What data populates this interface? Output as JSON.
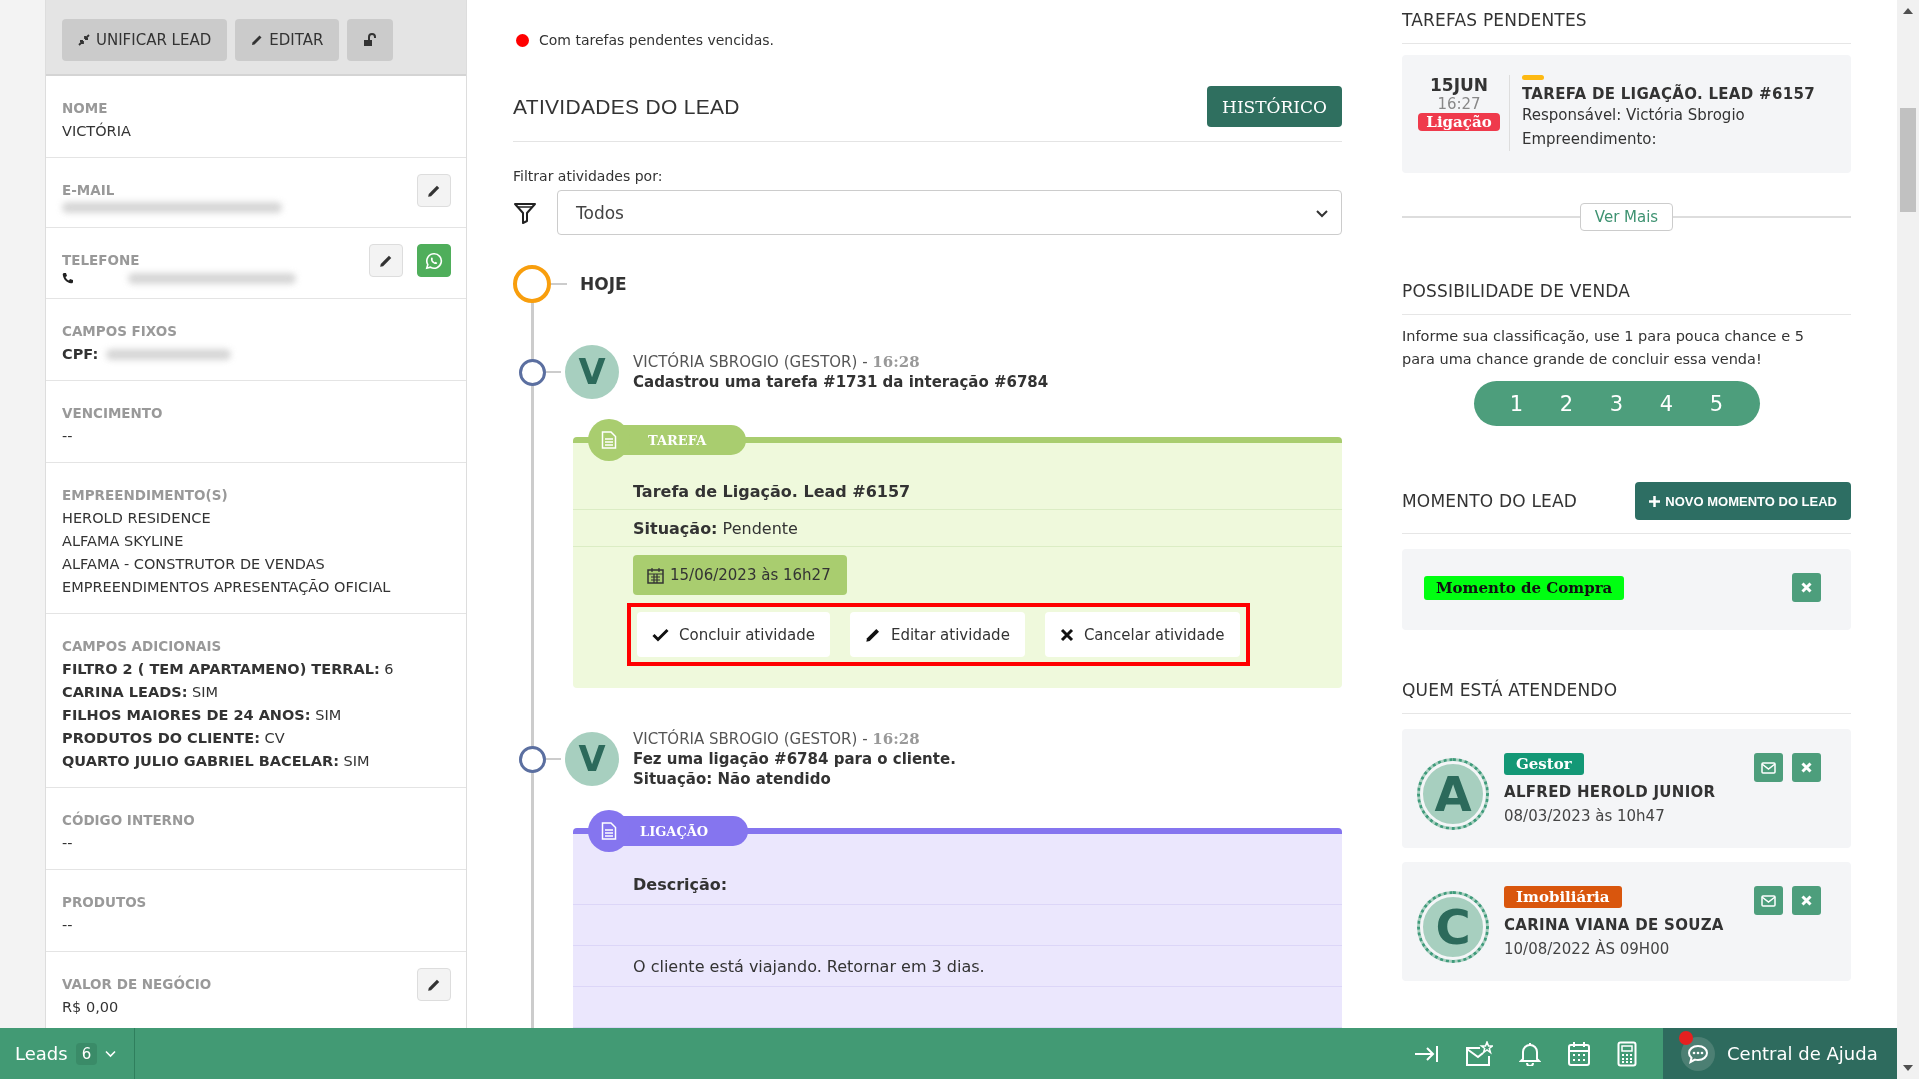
{
  "lead_panel": {
    "actions": [
      {
        "kind": "merge",
        "label": "UNIFICAR LEAD"
      },
      {
        "kind": "edit",
        "label": "EDITAR"
      },
      {
        "kind": "unlock"
      }
    ],
    "fields": [
      {
        "label": "NOME",
        "editable": false,
        "whatsapp": false,
        "lines": [
          {
            "kind": "text",
            "value": "VICTÓRIA"
          }
        ]
      },
      {
        "label": "E-MAIL",
        "editable": true,
        "whatsapp": false,
        "lines": [
          {
            "kind": "blurred"
          }
        ]
      },
      {
        "label": "TELEFONE",
        "editable": true,
        "whatsapp": true,
        "lines": [
          {
            "kind": "phone"
          }
        ]
      },
      {
        "label": "CAMPOS FIXOS",
        "editable": false,
        "whatsapp": false,
        "lines": [
          {
            "kind": "blurred",
            "key": "CPF:"
          }
        ]
      },
      {
        "label": "VENCIMENTO",
        "editable": false,
        "whatsapp": false,
        "lines": [
          {
            "kind": "text",
            "value": "--"
          }
        ]
      },
      {
        "label": "EMPREENDIMENTO(S)",
        "editable": false,
        "whatsapp": false,
        "lines": [
          {
            "kind": "text",
            "value": "HEROLD RESIDENCE"
          },
          {
            "kind": "text",
            "value": "ALFAMA SKYLINE"
          },
          {
            "kind": "text",
            "value": "ALFAMA - CONSTRUTOR DE VENDAS"
          },
          {
            "kind": "text",
            "value": "EMPREENDIMENTOS APRESENTAÇÃO OFICIAL"
          }
        ]
      },
      {
        "label": "CAMPOS ADICIONAIS",
        "editable": false,
        "whatsapp": false,
        "lines": [
          {
            "kind": "pair",
            "key": "FILTRO 2 ( TEM APARTAMENO) TERRAL:",
            "value": "6"
          },
          {
            "kind": "pair",
            "key": "CARINA LEADS:",
            "value": "SIM"
          },
          {
            "kind": "pair",
            "key": "FILHOS MAIORES DE 24 ANOS:",
            "value": "SIM"
          },
          {
            "kind": "pair",
            "key": "PRODUTOS DO CLIENTE:",
            "value": "CV"
          },
          {
            "kind": "pair",
            "key": "QUARTO JULIO GABRIEL BACELAR:",
            "value": "SIM"
          }
        ]
      },
      {
        "label": "CÓDIGO INTERNO",
        "editable": false,
        "whatsapp": false,
        "lines": [
          {
            "kind": "text",
            "value": "--"
          }
        ]
      },
      {
        "label": "PRODUTOS",
        "editable": false,
        "whatsapp": false,
        "lines": [
          {
            "kind": "text",
            "value": "--"
          }
        ]
      },
      {
        "label": "VALOR DE NEGÓCIO",
        "editable": true,
        "whatsapp": false,
        "lines": [
          {
            "kind": "text",
            "value": "R$ 0,00"
          }
        ]
      }
    ]
  },
  "alert": {
    "text": "Com tarefas pendentes vencidas."
  },
  "activities": {
    "title": "ATIVIDADES DO LEAD",
    "history_button": "HISTÓRICO",
    "filter_label": "Filtrar atividades por:",
    "filter_value": "Todos",
    "day": "HOJE",
    "items": [
      {
        "author": "VICTÓRIA SBROGIO (GESTOR) -",
        "time": "16:28",
        "avatar": "V",
        "summary": [
          "Cadastrou uma tarefa #1731 da interação #6784"
        ],
        "card": {
          "kind": "task",
          "tag": "TAREFA",
          "title": "Tarefa de Ligação. Lead #6157",
          "status_label": "Situação:",
          "status": "Pendente",
          "date": "15/06/2023 às 16h27",
          "highlighted": true,
          "actions": [
            {
              "kind": "done",
              "label": "Concluir atividade"
            },
            {
              "kind": "edit",
              "label": "Editar atividade"
            },
            {
              "kind": "cancel",
              "label": "Cancelar atividade"
            }
          ]
        }
      },
      {
        "author": "VICTÓRIA SBROGIO (GESTOR) -",
        "time": "16:28",
        "avatar": "V",
        "summary": [
          "Fez uma ligação #6784 para o cliente.",
          "Situação: Não atendido"
        ],
        "card": {
          "kind": "call",
          "tag": "LIGAÇÃO",
          "description_label": "Descrição:",
          "description": "O cliente está viajando. Retornar em 3 dias."
        }
      }
    ]
  },
  "pending_tasks": {
    "title": "TAREFAS PENDENTES",
    "tasks": [
      {
        "day": "15JUN",
        "time": "16:27",
        "type": "Ligação",
        "title": "TAREFA DE LIGAÇÃO. LEAD #6157",
        "lines": [
          "Responsável: Victória Sbrogio",
          "Empreendimento:"
        ]
      }
    ],
    "more": "Ver Mais"
  },
  "sale_chance": {
    "title": "POSSIBILIDADE DE VENDA",
    "text": "Informe sua classificação, use 1 para pouca chance e 5 para uma chance grande de concluir essa venda!",
    "ratings": [
      "1",
      "2",
      "3",
      "4",
      "5"
    ]
  },
  "lead_moment": {
    "title": "MOMENTO DO LEAD",
    "button": "NOVO MOMENTO DO LEAD",
    "tags": [
      "Momento de Compra"
    ]
  },
  "attendants": {
    "title": "QUEM ESTÁ ATENDENDO",
    "people": [
      {
        "initial": "A",
        "role": "Gestor",
        "color": "#139876",
        "name": "ALFRED HEROLD JUNIOR",
        "date": "08/03/2023 às 10h47"
      },
      {
        "initial": "C",
        "role": "Imobiliária",
        "color": "#d9560d",
        "name": "CARINA VIANA DE SOUZA",
        "date": "10/08/2022 ÀS 09H00"
      }
    ]
  },
  "bottom_bar": {
    "module": "Leads",
    "count": "6",
    "help": "Central de Ajuda",
    "help_notification": true
  }
}
